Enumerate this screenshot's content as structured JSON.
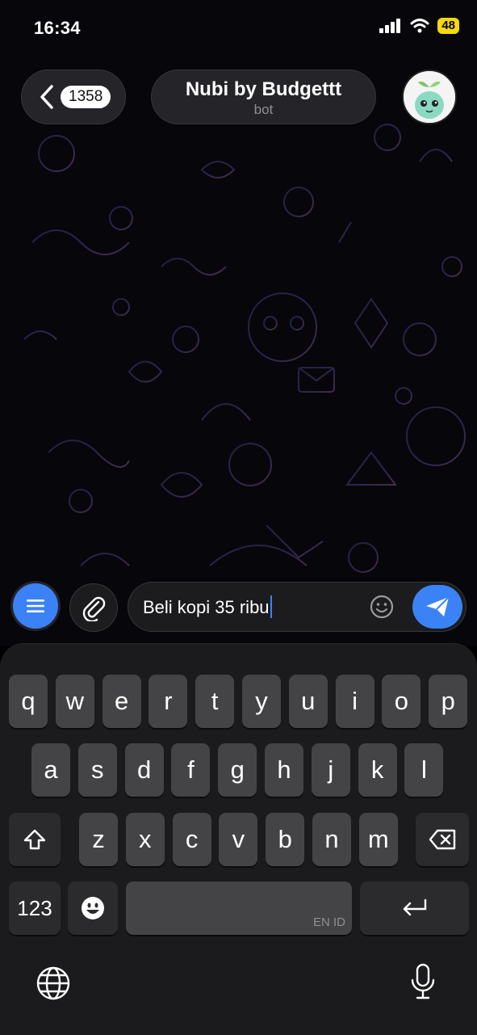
{
  "status_bar": {
    "time": "16:34",
    "battery": "48"
  },
  "header": {
    "back_badge": "1358",
    "chat_title": "Nubi by Budgettt",
    "chat_subtitle": "bot"
  },
  "composer": {
    "text": "Beli kopi 35 ribu"
  },
  "keyboard": {
    "row1": [
      "q",
      "w",
      "e",
      "r",
      "t",
      "y",
      "u",
      "i",
      "o",
      "p"
    ],
    "row2": [
      "a",
      "s",
      "d",
      "f",
      "g",
      "h",
      "j",
      "k",
      "l"
    ],
    "row3": [
      "z",
      "x",
      "c",
      "v",
      "b",
      "n",
      "m"
    ],
    "numbers_key": "123",
    "space_sublabel": "EN ID"
  },
  "colors": {
    "accent": "#3b82f6",
    "battery": "#f5d90a"
  },
  "icons": [
    "back-chevron-icon",
    "menu-icon",
    "paperclip-icon",
    "smiley-icon",
    "send-icon",
    "shift-icon",
    "backspace-icon",
    "emoji-icon",
    "return-icon",
    "globe-icon",
    "microphone-icon"
  ]
}
